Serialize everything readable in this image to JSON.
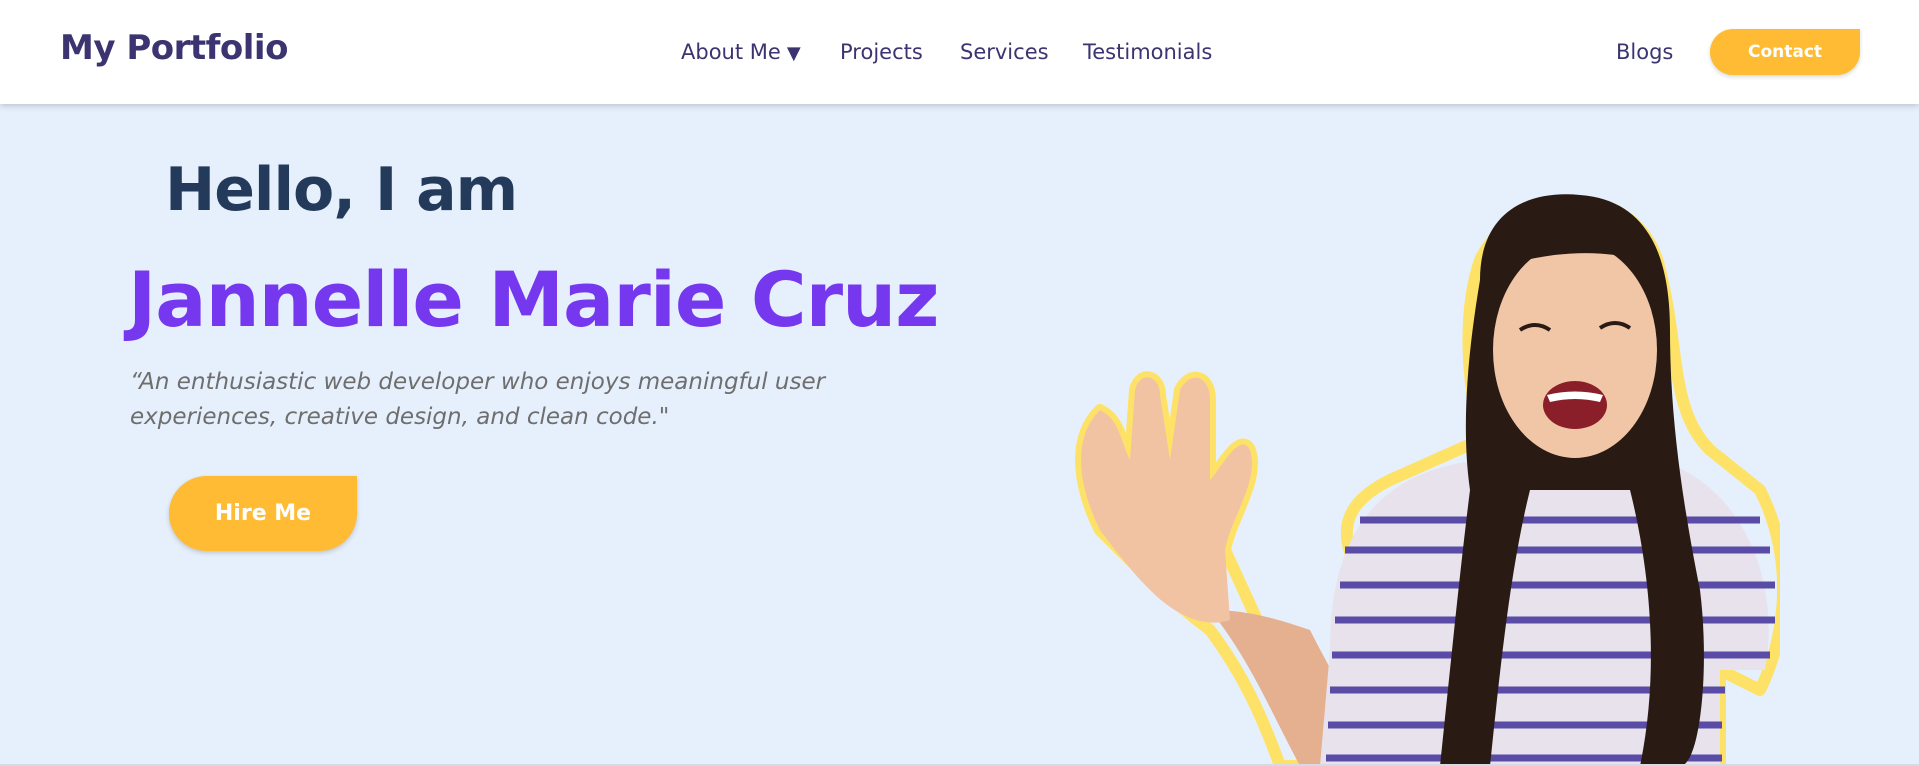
{
  "nav": {
    "logo": "My Portfolio",
    "links": {
      "about": "About Me",
      "about_caret": "▼",
      "projects": "Projects",
      "services": "Services",
      "testimonials": "Testimonials",
      "blogs": "Blogs"
    },
    "contact_label": "Contact"
  },
  "hero": {
    "greeting": "Hello, I am",
    "name": "Jannelle Marie Cruz",
    "tagline": "“An enthusiastic web developer who enjoys meaningful user experiences, creative design, and clean code.\"",
    "cta_label": "Hire Me",
    "portrait_icon": "waving-person-photo"
  },
  "colors": {
    "background": "#e6f0fc",
    "navbar": "#ffffff",
    "logo": "#3b3470",
    "greeting": "#243a5a",
    "name": "#7638ee",
    "tagline": "#6e6e6e",
    "accent": "#ffbb33"
  }
}
